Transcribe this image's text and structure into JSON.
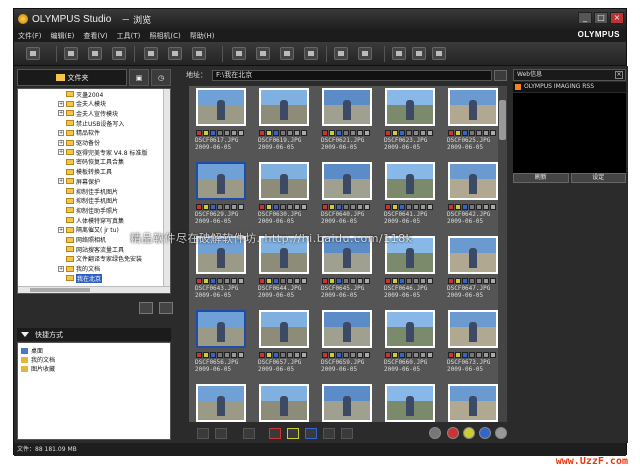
{
  "window": {
    "title": "OLYMPUS Studio",
    "subtitle": "－ 浏览",
    "brand": "OLYMPUS"
  },
  "menu": [
    "文件(F)",
    "编辑(E)",
    "查看(V)",
    "工具(T)",
    "照相机(C)",
    "帮助(H)"
  ],
  "left_panel": {
    "tab_folders": "文件夹",
    "tree": [
      {
        "label": "灭蛊2004",
        "expander": false
      },
      {
        "label": "金夫人模块",
        "expander": true
      },
      {
        "label": "金夫人宣传模块",
        "expander": true
      },
      {
        "label": "禁止USB设备写入",
        "expander": false
      },
      {
        "label": "精品软件",
        "expander": true
      },
      {
        "label": "驱动备份",
        "expander": true
      },
      {
        "label": "驱得完美专家 V4.8 标准版",
        "expander": true
      },
      {
        "label": "密码恢复工具合集",
        "expander": false
      },
      {
        "label": "模板转换工具",
        "expander": false
      },
      {
        "label": "屏幕保护",
        "expander": true
      },
      {
        "label": "抑制佳手机图片",
        "expander": false
      },
      {
        "label": "抑制佳手机图片",
        "expander": false
      },
      {
        "label": "抑制佳助手照片",
        "expander": false
      },
      {
        "label": "人体模特穿写真集",
        "expander": false
      },
      {
        "label": "隔离催又( jr tu)",
        "expander": true
      },
      {
        "label": "网络照相机",
        "expander": false
      },
      {
        "label": "网站搜客流量工具",
        "expander": false
      },
      {
        "label": "文件翻译专家绿色免安装",
        "expander": false
      },
      {
        "label": "我的文档",
        "expander": true
      },
      {
        "label": "我在北京",
        "expander": false,
        "selected": true
      }
    ],
    "shortcuts_title": "快捷方式",
    "shortcuts": [
      "桌面",
      "我的文档",
      "图片收藏"
    ]
  },
  "address": {
    "label": "地址：",
    "value": "F:\\我在北京"
  },
  "thumbnails": [
    {
      "name": "DSCF0617.JPG",
      "date": "2009-06-05"
    },
    {
      "name": "DSCF0619.JPG",
      "date": "2009-06-05"
    },
    {
      "name": "DSCF0621.JPG",
      "date": "2009-06-05"
    },
    {
      "name": "DSCF0623.JPG",
      "date": "2009-06-05"
    },
    {
      "name": "DSCF0625.JPG",
      "date": "2009-06-05"
    },
    {
      "name": "DSCF0629.JPG",
      "date": "2009-06-05"
    },
    {
      "name": "DSCF0630.JPG",
      "date": "2009-06-05"
    },
    {
      "name": "DSCF0640.JPG",
      "date": "2009-06-05"
    },
    {
      "name": "DSCF0641.JPG",
      "date": "2009-06-05"
    },
    {
      "name": "DSCF0642.JPG",
      "date": "2009-06-05"
    },
    {
      "name": "DSCF0643.JPG",
      "date": "2009-06-05"
    },
    {
      "name": "DSCF0644.JPG",
      "date": "2009-06-05"
    },
    {
      "name": "DSCF0645.JPG",
      "date": "2009-06-05"
    },
    {
      "name": "DSCF0646.JPG",
      "date": "2009-06-05"
    },
    {
      "name": "DSCF0647.JPG",
      "date": "2009-06-05"
    },
    {
      "name": "DSCF0656.JPG",
      "date": "2009-06-05"
    },
    {
      "name": "DSCF0657.JPG",
      "date": "2009-06-05"
    },
    {
      "name": "DSCF0659.JPG",
      "date": "2009-06-05"
    },
    {
      "name": "DSCF0660.JPG",
      "date": "2009-06-05"
    },
    {
      "name": "DSCF0673.JPG",
      "date": "2009-06-05"
    },
    {
      "name": "",
      "date": ""
    },
    {
      "name": "",
      "date": ""
    },
    {
      "name": "",
      "date": ""
    },
    {
      "name": "",
      "date": ""
    },
    {
      "name": "",
      "date": ""
    }
  ],
  "right_panel": {
    "title": "Web信息",
    "feed": "OLYMPUS IMAGING RSS",
    "refresh": "刷新",
    "settings": "设定"
  },
  "status": "文件：88 181.09 MB",
  "watermark": "精品软件尽在破解软件坊. http://hi.baidu.com/118k",
  "footer": "www.UzzF.com",
  "colors": {
    "selection_border": "#1e4da8",
    "footer": "#e8380d"
  }
}
